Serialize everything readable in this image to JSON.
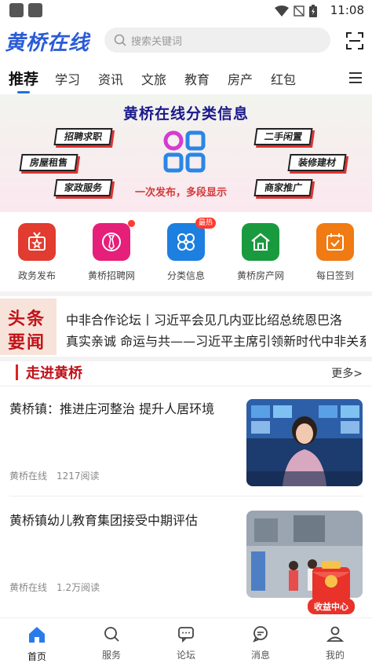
{
  "status": {
    "time": "11:08"
  },
  "header": {
    "logo": "黄桥在线",
    "search_placeholder": "搜索关键词"
  },
  "tabs": [
    {
      "label": "推荐"
    },
    {
      "label": "学习"
    },
    {
      "label": "资讯"
    },
    {
      "label": "文旅"
    },
    {
      "label": "教育"
    },
    {
      "label": "房产"
    },
    {
      "label": "红包"
    }
  ],
  "banner": {
    "title": "黄桥在线分类信息",
    "tags": [
      "招聘求职",
      "二手闲置",
      "房屋租售",
      "装修建材",
      "家政服务",
      "商家推广"
    ],
    "subtitle": "一次发布，多段显示"
  },
  "quick": [
    {
      "label": "政务发布",
      "color": "#e23b2f"
    },
    {
      "label": "黄桥招聘网",
      "color": "#e61f7a"
    },
    {
      "label": "分类信息",
      "color": "#1d7fe0",
      "badge": "最热"
    },
    {
      "label": "黄桥房产网",
      "color": "#1a9a3f"
    },
    {
      "label": "每日签到",
      "color": "#f07a13"
    }
  ],
  "headline": {
    "logo_line1": "头条",
    "logo_line2": "要闻",
    "items": [
      "中非合作论坛丨习近平会见几内亚比绍总统恩巴洛",
      "真实亲诚 命运与共——习近平主席引领新时代中非关系"
    ]
  },
  "section": {
    "title": "走进黄桥",
    "more": "更多>"
  },
  "news": [
    {
      "title": "黄桥镇：推进庄河整治 提升人居环境",
      "source": "黄桥在线",
      "reads": "1217阅读"
    },
    {
      "title": "黄桥镇幼儿教育集团接受中期评估",
      "source": "黄桥在线",
      "reads": "1.2万阅读"
    }
  ],
  "float": {
    "label": "收益中心"
  },
  "tabbar": [
    {
      "label": "首页"
    },
    {
      "label": "服务"
    },
    {
      "label": "论坛"
    },
    {
      "label": "消息"
    },
    {
      "label": "我的"
    }
  ]
}
